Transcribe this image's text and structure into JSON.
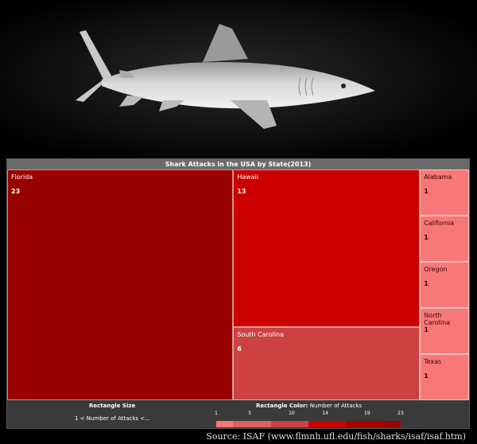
{
  "chart_data": {
    "type": "treemap",
    "title": "Shark Attacks in the USA by State(2013)",
    "items": [
      {
        "label": "Florida",
        "value": 23,
        "color": "#990000"
      },
      {
        "label": "Hawaii",
        "value": 13,
        "color": "#cc0000"
      },
      {
        "label": "South Carolina",
        "value": 6,
        "color": "#cc4141"
      },
      {
        "label": "Alabama",
        "value": 1,
        "color": "#f87878"
      },
      {
        "label": "California",
        "value": 1,
        "color": "#f87878"
      },
      {
        "label": "Oregon",
        "value": 1,
        "color": "#f87878"
      },
      {
        "label": "North Carolina",
        "value": 1,
        "color": "#f87878"
      },
      {
        "label": "Texas",
        "value": 1,
        "color": "#f87878"
      }
    ],
    "legend": {
      "size_title": "Rectangle Size",
      "size_description": "1 < Number of Attacks <...",
      "color_title": "Rectangle Color:",
      "color_measure": "Number of Attacks",
      "color_ticks": [
        "1",
        "5",
        "10",
        "14",
        "19",
        "23"
      ],
      "color_scale": [
        "#f87878",
        "#e06060",
        "#cc4141",
        "#cc0000",
        "#aa0000",
        "#990000"
      ]
    }
  },
  "source": "Source: ISAF (www.flmnh.ufl.edu/fish/sharks/isaf/isaf.htm)",
  "colors": {
    "background": "#000000",
    "panel": "#3a3a3a",
    "title_bar": "#6b6b6b"
  }
}
